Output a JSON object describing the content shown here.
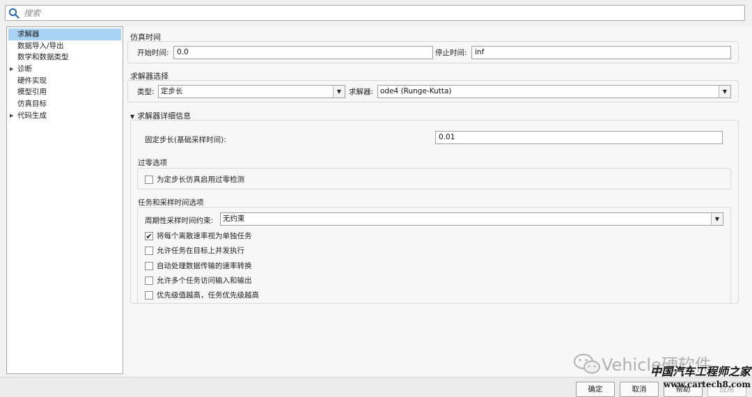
{
  "search": {
    "placeholder": "搜索",
    "value": ""
  },
  "tree": {
    "items": [
      {
        "label": "求解器",
        "selected": true,
        "expandable": false
      },
      {
        "label": "数据导入/导出",
        "selected": false,
        "expandable": false
      },
      {
        "label": "数学和数据类型",
        "selected": false,
        "expandable": false
      },
      {
        "label": "诊断",
        "selected": false,
        "expandable": true
      },
      {
        "label": "硬件实现",
        "selected": false,
        "expandable": false
      },
      {
        "label": "模型引用",
        "selected": false,
        "expandable": false
      },
      {
        "label": "仿真目标",
        "selected": false,
        "expandable": false
      },
      {
        "label": "代码生成",
        "selected": false,
        "expandable": true
      }
    ]
  },
  "sim_time": {
    "title": "仿真时间",
    "start_label": "开始时间:",
    "start_value": "0.0",
    "stop_label": "停止时间:",
    "stop_value": "inf"
  },
  "solver_select": {
    "title": "求解器选择",
    "type_label": "类型:",
    "type_value": "定步长",
    "solver_label": "求解器:",
    "solver_value": "ode4 (Runge-Kutta)"
  },
  "solver_details": {
    "title": "求解器详细信息",
    "step_label": "固定步长(基础采样时间):",
    "step_value": "0.01",
    "zero_crossing": {
      "title": "过零选项",
      "option": {
        "label": "为定步长仿真启用过零检测",
        "checked": false
      }
    },
    "tasking": {
      "title": "任务和采样时间选项",
      "periodic_label": "周期性采样时间约束:",
      "periodic_value": "无约束",
      "options": [
        {
          "label": "将每个离散速率视为单独任务",
          "checked": true
        },
        {
          "label": "允许任务在目标上并发执行",
          "checked": false
        },
        {
          "label": "自动处理数据传输的速率转换",
          "checked": false
        },
        {
          "label": "允许多个任务访问输入和输出",
          "checked": false
        },
        {
          "label": "优先级值越高，任务优先级越高",
          "checked": false
        }
      ]
    }
  },
  "buttons": {
    "ok": "确定",
    "cancel": "取消",
    "help": "帮助",
    "apply": "应用"
  },
  "watermark": {
    "text": "Vehicle硬软件"
  },
  "site_mark": {
    "line1": "中国汽车工程师之家",
    "line2": "www.cartech8.com"
  },
  "icons": {
    "search": "search-icon",
    "dropdown": "chevron-down-icon",
    "expand": "triangle-right-icon",
    "collapse": "triangle-down-icon",
    "check": "checkmark-icon",
    "watermark_logo": "wechat-icon"
  },
  "colors": {
    "selection": "#a9d3f5",
    "search_icon": "#2a6cb0"
  }
}
